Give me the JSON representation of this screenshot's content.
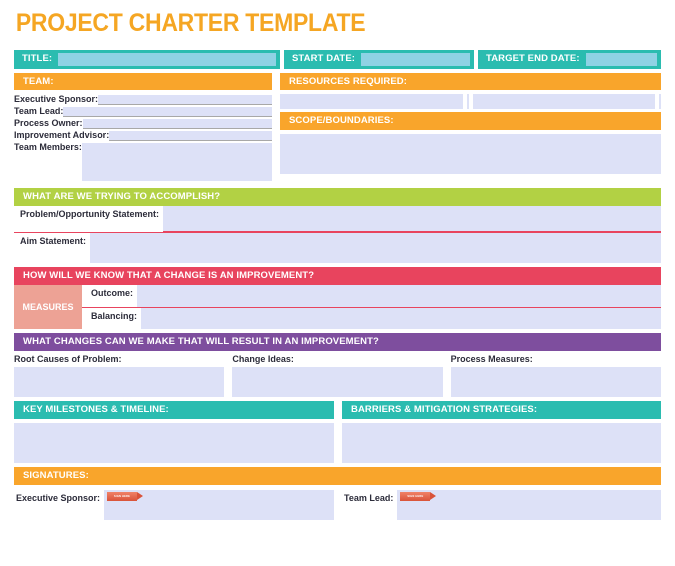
{
  "document": {
    "title": "PROJECT CHARTER TEMPLATE",
    "accent_orange": "#f5a623",
    "accent_teal": "#2bbcb0",
    "accent_green": "#b2d144",
    "accent_red": "#e8445e",
    "accent_purple": "#7e4e9e",
    "field_fill": "#dde1f7"
  },
  "title_row": {
    "title_label": "TITLE:",
    "title_value": "",
    "start_date_label": "START DATE:",
    "start_date_value": "",
    "target_end_label": "TARGET END DATE:",
    "target_end_value": ""
  },
  "team": {
    "header": "TEAM:",
    "fields": [
      {
        "label": "Executive Sponsor:",
        "value": ""
      },
      {
        "label": "Team Lead:",
        "value": ""
      },
      {
        "label": "Process Owner:",
        "value": ""
      },
      {
        "label": "Improvement Advisor:",
        "value": ""
      }
    ],
    "members_label": "Team Members:",
    "members_value": ""
  },
  "resources": {
    "header": "RESOURCES REQUIRED:",
    "values": [
      "",
      "",
      "",
      ""
    ]
  },
  "scope": {
    "header": "SCOPE/BOUNDARIES:",
    "value": ""
  },
  "accomplish": {
    "header": "WHAT ARE WE TRYING TO ACCOMPLISH?",
    "problem_label": "Problem/Opportunity Statement:",
    "problem_value": "",
    "aim_label": "Aim Statement:",
    "aim_value": ""
  },
  "measures": {
    "header": "HOW WILL WE KNOW THAT A CHANGE IS AN IMPROVEMENT?",
    "tag": "MEASURES",
    "outcome_label": "Outcome:",
    "outcome_value": "",
    "balancing_label": "Balancing:",
    "balancing_value": ""
  },
  "changes": {
    "header": "WHAT CHANGES CAN WE MAKE THAT WILL RESULT IN AN IMPROVEMENT?",
    "columns": [
      {
        "label": "Root Causes of Problem:",
        "value": ""
      },
      {
        "label": "Change Ideas:",
        "value": ""
      },
      {
        "label": "Process Measures:",
        "value": ""
      }
    ]
  },
  "milestones": {
    "header": "KEY MILESTONES & TIMELINE:",
    "value": ""
  },
  "barriers": {
    "header": "BARRIERS & MITIGATION STRATEGIES:",
    "value": ""
  },
  "signatures": {
    "header": "SIGNATURES:",
    "badge_text": "SIGN HERE",
    "rows": [
      {
        "label": "Executive Sponsor:",
        "value": ""
      },
      {
        "label": "Team Lead:",
        "value": ""
      }
    ]
  }
}
